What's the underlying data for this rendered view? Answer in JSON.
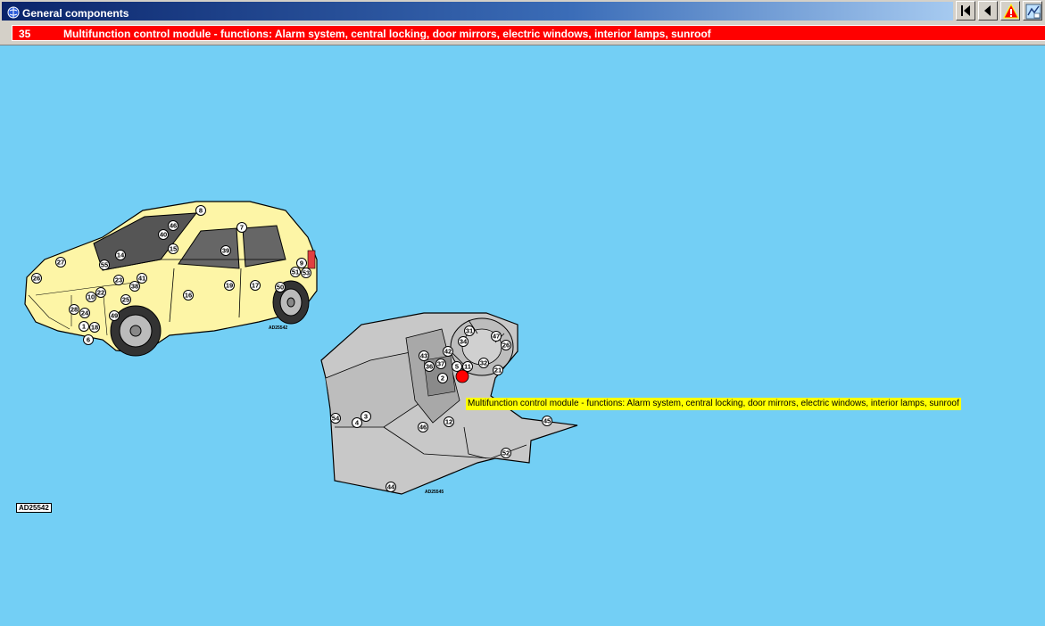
{
  "window": {
    "title": "General components",
    "buttons": [
      {
        "name": "first-page-button",
        "icon": "skip-first-icon"
      },
      {
        "name": "previous-page-button",
        "icon": "arrow-left-icon"
      },
      {
        "name": "warning-button",
        "icon": "warning-icon"
      },
      {
        "name": "diagram-button",
        "icon": "diagram-icon"
      }
    ]
  },
  "component": {
    "number": "35",
    "description": "Multifunction control module - functions: Alarm system, central locking, door mirrors, electric windows, interior lamps, sunroof"
  },
  "tooltip": "Multifunction control module - functions: Alarm system, central locking, door mirrors, electric windows, interior lamps, sunroof",
  "figure_refs": {
    "main": "AD25542",
    "car": "AD25542",
    "dashboard": "AD25545"
  },
  "car_callouts": [
    "8",
    "46",
    "40",
    "7",
    "15",
    "39",
    "14",
    "27",
    "55",
    "41",
    "23",
    "38",
    "9",
    "51",
    "53",
    "26",
    "22",
    "10",
    "16",
    "19",
    "17",
    "50",
    "25",
    "28",
    "24",
    "49",
    "1",
    "18",
    "6"
  ],
  "dash_callouts": [
    "31",
    "47",
    "34",
    "26",
    "42",
    "43",
    "37",
    "36",
    "5",
    "11",
    "32",
    "21",
    "2",
    "12",
    "54",
    "3",
    "4",
    "46",
    "45",
    "52",
    "44"
  ],
  "highlight": {
    "component": "35",
    "color": "#ff0000"
  },
  "colors": {
    "background": "#73cff5",
    "car_body": "#fdf5a6",
    "dashboard": "#c8c8c8",
    "title_bar": "#0a246a",
    "info_bar": "#ff0000",
    "tooltip": "#ffff00"
  }
}
